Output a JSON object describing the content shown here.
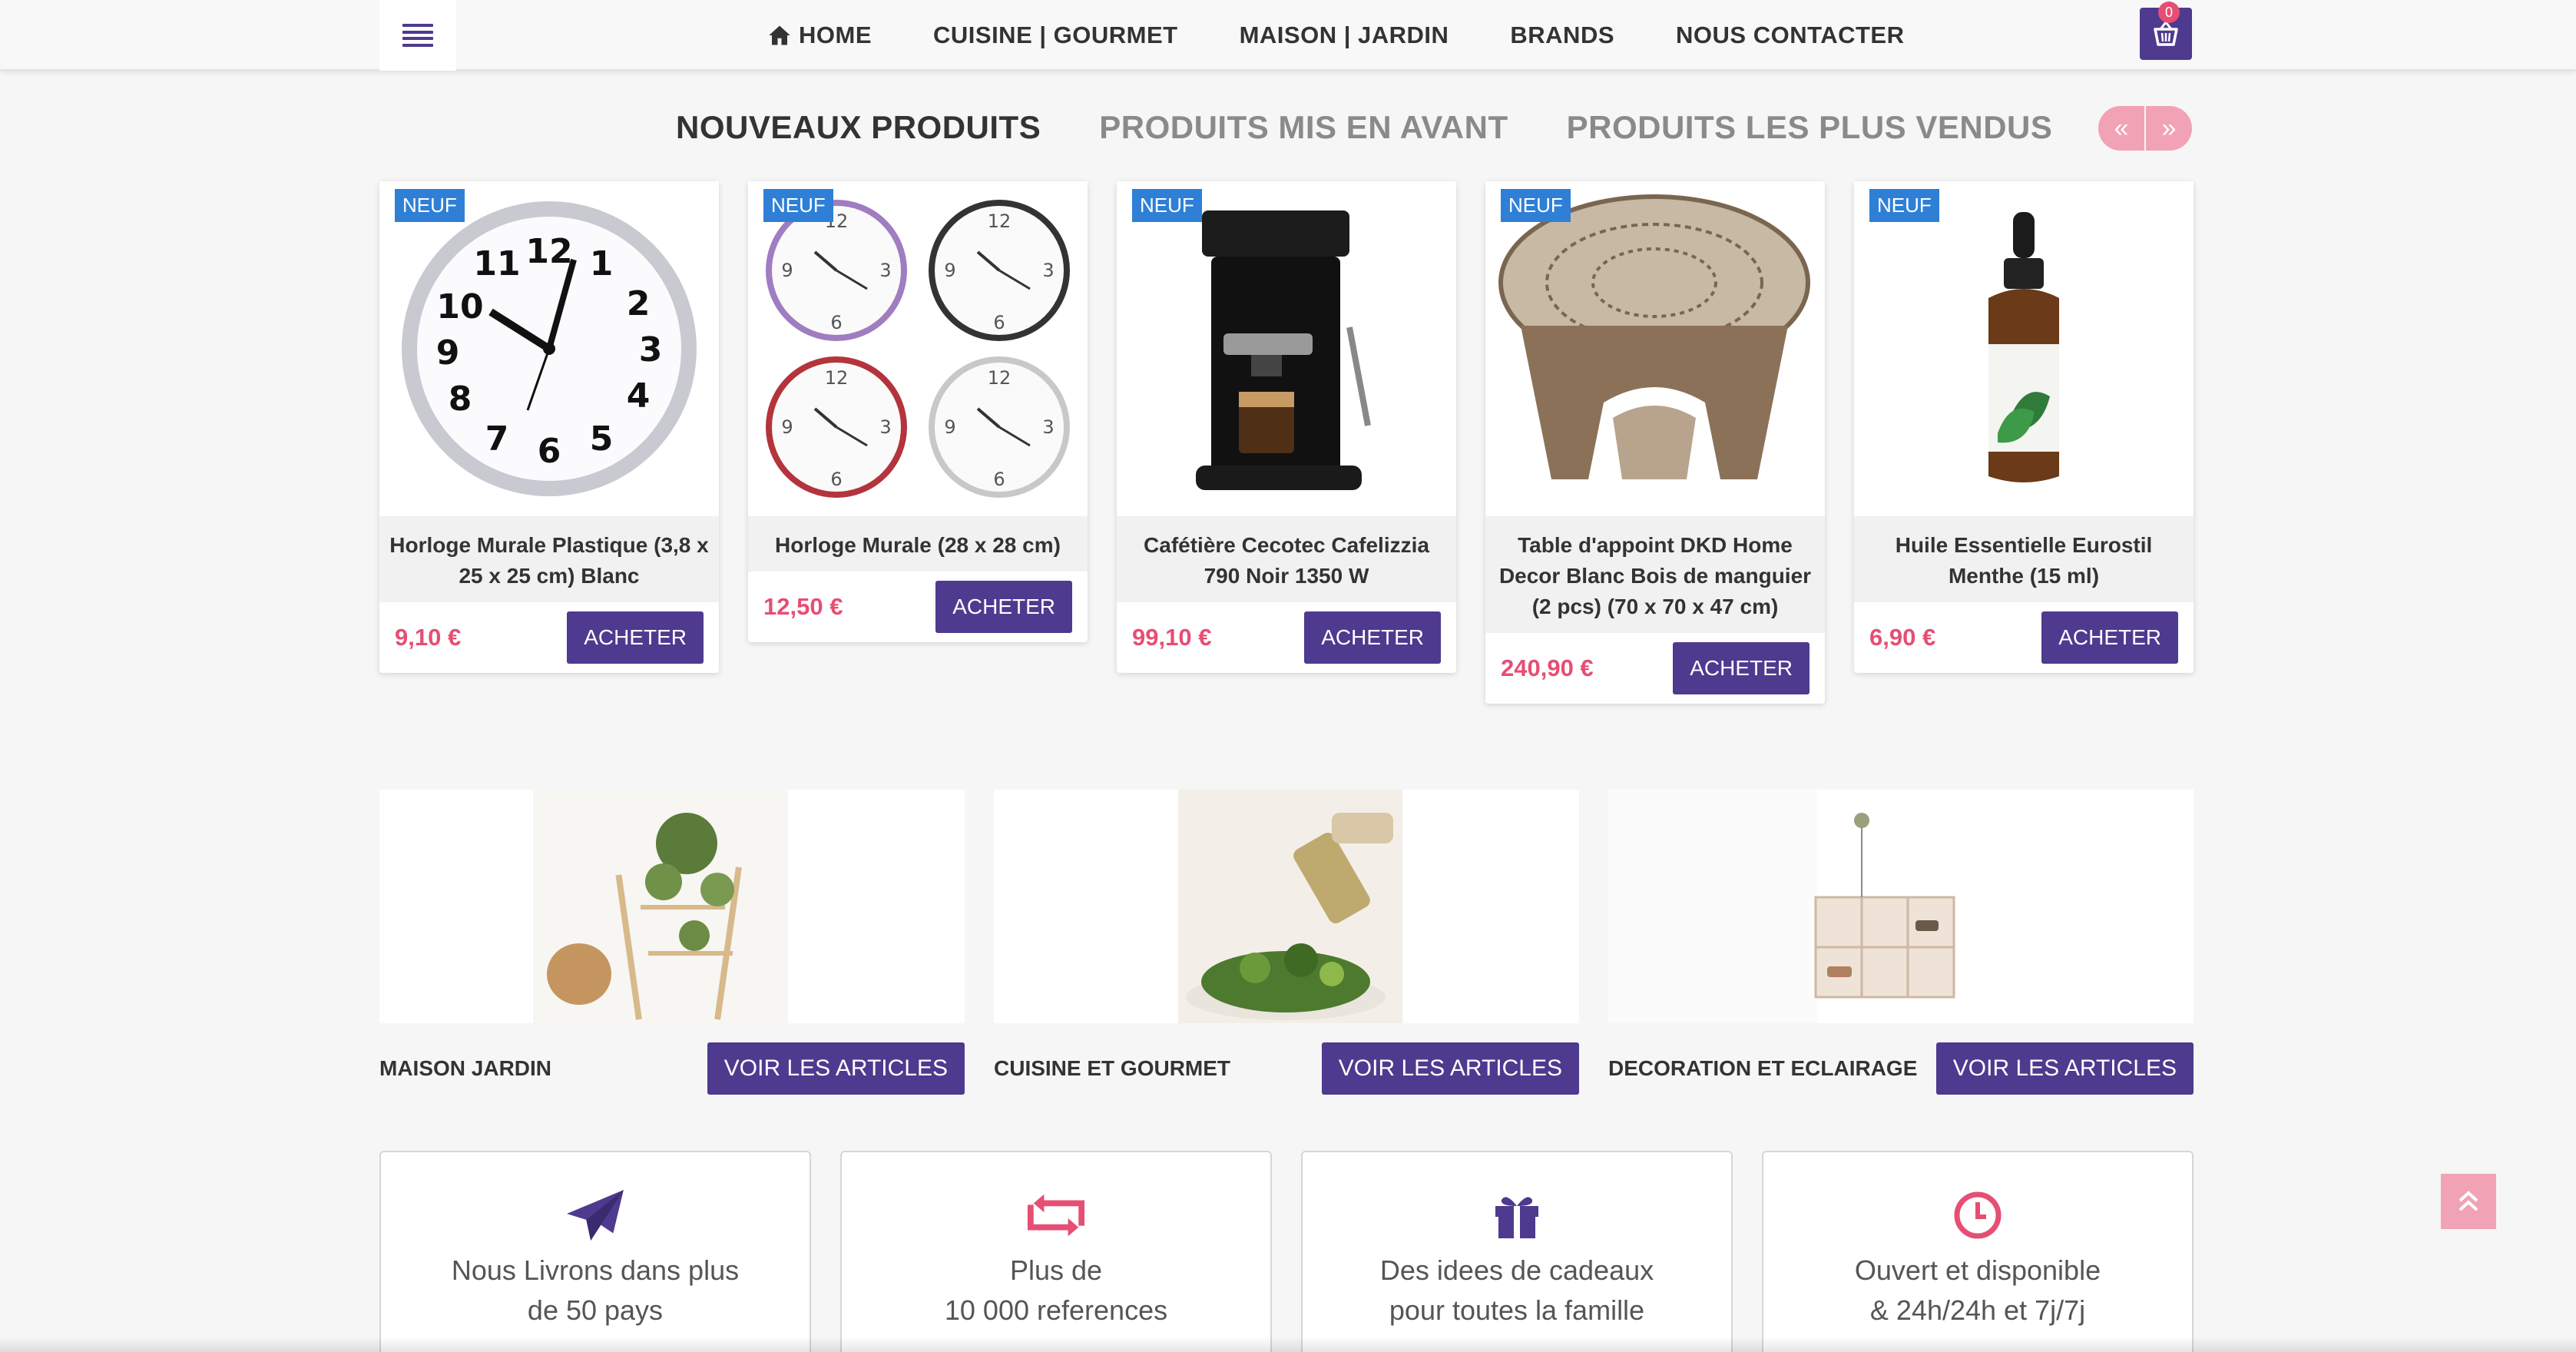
{
  "header": {
    "menu_icon": "hamburger-icon",
    "nav": [
      {
        "label": "HOME",
        "icon": "home-icon"
      },
      {
        "label": "CUISINE | GOURMET"
      },
      {
        "label": "MAISON | JARDIN"
      },
      {
        "label": "BRANDS"
      },
      {
        "label": "NOUS CONTACTER"
      }
    ],
    "cart": {
      "icon": "basket-icon",
      "count": "0"
    }
  },
  "tabs": [
    {
      "label": "NOUVEAUX PRODUITS",
      "active": true
    },
    {
      "label": "PRODUITS MIS EN AVANT",
      "active": false
    },
    {
      "label": "PRODUITS LES PLUS VENDUS",
      "active": false
    }
  ],
  "carousel": {
    "prev": "«",
    "next": "»"
  },
  "products": [
    {
      "badge": "NEUF",
      "title": "Horloge Murale Plastique (3,8 x 25 x 25 cm) Blanc",
      "price": "9,10 €",
      "buy": "ACHETER"
    },
    {
      "badge": "NEUF",
      "title": "Horloge Murale (28 x 28 cm)",
      "price": "12,50 €",
      "buy": "ACHETER"
    },
    {
      "badge": "NEUF",
      "title": "Cafétière Cecotec Cafelizzia 790 Noir 1350 W",
      "price": "99,10 €",
      "buy": "ACHETER"
    },
    {
      "badge": "NEUF",
      "title": "Table d'appoint DKD Home Decor Blanc Bois de manguier (2 pcs) (70 x 70 x 47 cm)",
      "price": "240,90 €",
      "buy": "ACHETER"
    },
    {
      "badge": "NEUF",
      "title": "Huile Essentielle Eurostil Menthe (15 ml)",
      "price": "6,90 €",
      "buy": "ACHETER"
    }
  ],
  "categories": [
    {
      "name": "MAISON JARDIN",
      "button": "VOIR LES ARTICLES"
    },
    {
      "name": "CUISINE ET GOURMET",
      "button": "VOIR LES ARTICLES"
    },
    {
      "name": "DECORATION ET ECLAIRAGE",
      "button": "VOIR LES ARTICLES"
    }
  ],
  "info": [
    {
      "icon": "paper-plane-icon",
      "line1": "Nous Livrons dans plus",
      "line2": "de 50 pays"
    },
    {
      "icon": "retweet-icon",
      "line1": "Plus de",
      "line2": "10 000 references"
    },
    {
      "icon": "gift-icon",
      "line1": "Des idees de cadeaux",
      "line2": "pour toutes la famille"
    },
    {
      "icon": "clock-icon",
      "line1": "Ouvert et disponible",
      "line2": "& 24h/24h et 7j/7j"
    }
  ],
  "colors": {
    "brand": "#4e3a8e",
    "price": "#e64e74",
    "badge": "#2f7fd6",
    "accent_soft": "#f2a2b5"
  }
}
